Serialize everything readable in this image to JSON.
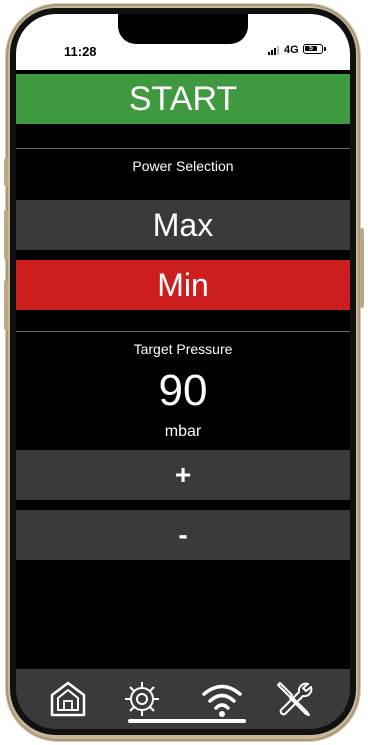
{
  "status_bar": {
    "time": "11:28",
    "network": "4G",
    "battery": "5"
  },
  "controls": {
    "start_label": "START"
  },
  "power": {
    "label": "Power Selection",
    "options": [
      "Max",
      "Min"
    ],
    "selected": "Min"
  },
  "pressure": {
    "label": "Target Pressure",
    "value": "90",
    "unit": "mbar",
    "increment_label": "+",
    "decrement_label": "-"
  },
  "nav": {
    "items": [
      "home-icon",
      "gear-icon",
      "wifi-icon",
      "tools-icon"
    ]
  },
  "colors": {
    "start": "#3f9a3f",
    "selected": "#cc1e1e",
    "button": "#3a3a3a",
    "background": "#000000",
    "frame": "#c8b89a"
  }
}
